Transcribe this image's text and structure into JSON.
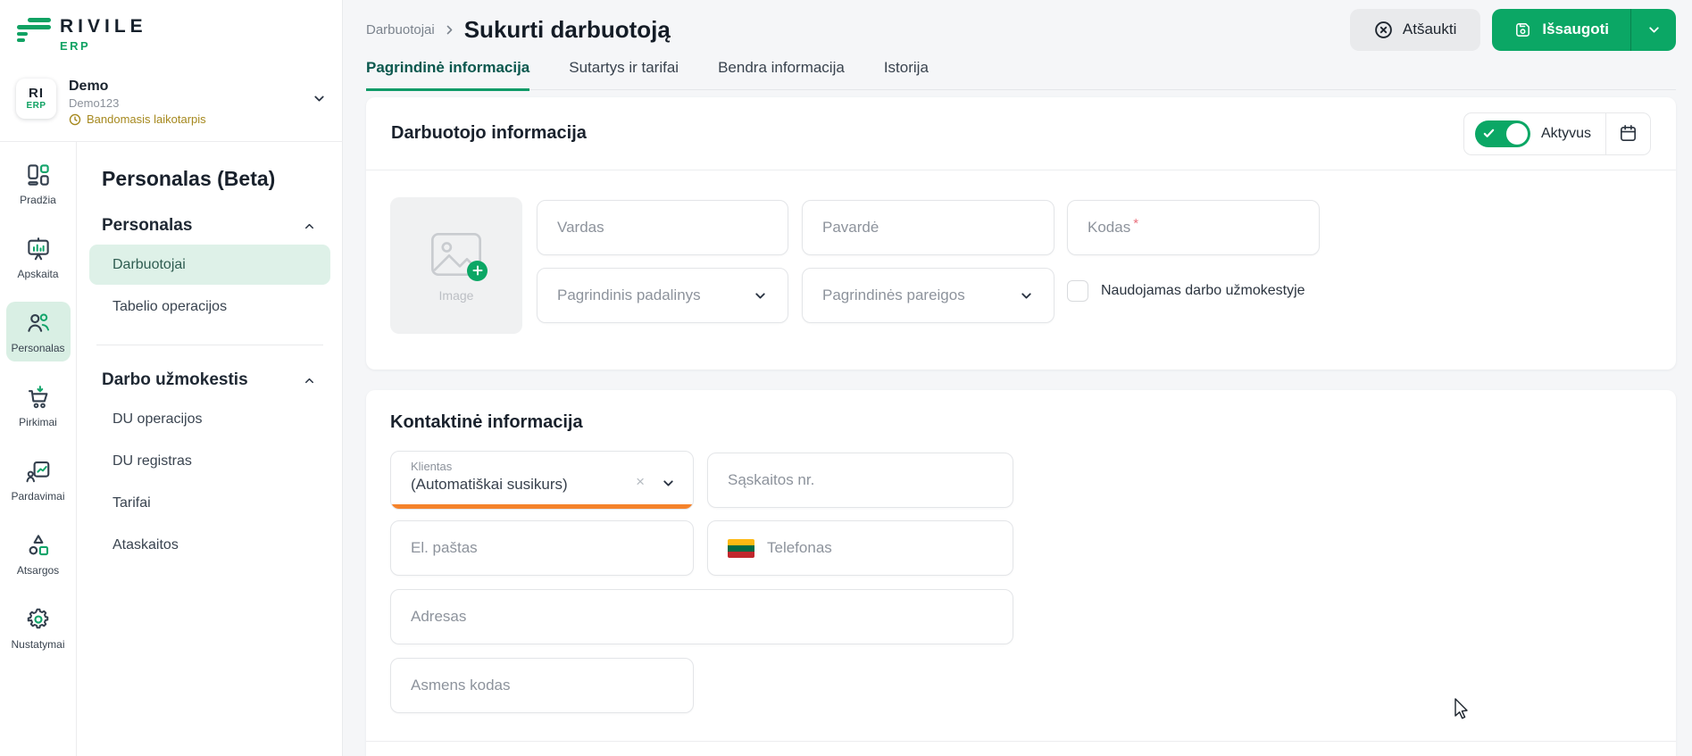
{
  "colors": {
    "brand_green": "#0ba765",
    "dark_navy": "#333f4d",
    "accent_orange": "#f5832b",
    "trial_gold": "#a6891f",
    "selected_mint": "#def1e8",
    "active_tab_green": "#0f9b68",
    "required_red": "#e9707d",
    "lt_flag_yellow": "#fdb913",
    "lt_flag_green": "#006a44",
    "lt_flag_red": "#c1272d"
  },
  "brand": {
    "name": "RIVILE",
    "product": "ERP"
  },
  "company": {
    "avatar_line1": "RI",
    "avatar_line2": "ERP",
    "name": "Demo",
    "code": "Demo123",
    "trial_label": "Bandomasis laikotarpis"
  },
  "nav_rail": {
    "items": [
      {
        "label": "Pradžia",
        "active": false
      },
      {
        "label": "Apskaita",
        "active": false
      },
      {
        "label": "Personalas",
        "active": true
      },
      {
        "label": "Pirkimai",
        "active": false
      },
      {
        "label": "Pardavimai",
        "active": false
      },
      {
        "label": "Atsargos",
        "active": false
      },
      {
        "label": "Nustatymai",
        "active": false
      }
    ]
  },
  "sidebar": {
    "title": "Personalas (Beta)",
    "sections": [
      {
        "title": "Personalas",
        "items": [
          {
            "label": "Darbuotojai",
            "active": true
          },
          {
            "label": "Tabelio operacijos",
            "active": false
          }
        ]
      },
      {
        "title": "Darbo užmokestis",
        "items": [
          {
            "label": "DU operacijos",
            "active": false
          },
          {
            "label": "DU registras",
            "active": false
          },
          {
            "label": "Tarifai",
            "active": false
          },
          {
            "label": "Ataskaitos",
            "active": false
          }
        ]
      }
    ]
  },
  "header": {
    "breadcrumb": "Darbuotojai",
    "title": "Sukurti darbuotoją",
    "cancel_label": "Atšaukti",
    "save_label": "Išsaugoti"
  },
  "tabs": [
    {
      "label": "Pagrindinė informacija",
      "active": true
    },
    {
      "label": "Sutartys ir tarifai",
      "active": false
    },
    {
      "label": "Bendra informacija",
      "active": false
    },
    {
      "label": "Istorija",
      "active": false
    }
  ],
  "employee_card": {
    "title": "Darbuotojo informacija",
    "toggle_label": "Aktyvus",
    "toggle_on": true,
    "image_label": "Image",
    "vardas_placeholder": "Vardas",
    "pavarde_placeholder": "Pavardė",
    "kodas_placeholder": "Kodas",
    "required_mark": "*",
    "padalinys_placeholder": "Pagrindinis padalinys",
    "pareigos_placeholder": "Pagrindinės pareigos",
    "payroll_checkbox_label": "Naudojamas darbo užmokestyje",
    "payroll_checkbox_checked": false
  },
  "contact_card": {
    "title": "Kontaktinė informacija",
    "klientas_label": "Klientas",
    "klientas_value": "(Automatiškai susikurs)",
    "klientas_clear": "×",
    "saskaitos_placeholder": "Sąskaitos nr.",
    "el_pastas_placeholder": "El. paštas",
    "telefonas_placeholder": "Telefonas",
    "adresas_placeholder": "Adresas",
    "asmens_kodas_placeholder": "Asmens kodas"
  }
}
